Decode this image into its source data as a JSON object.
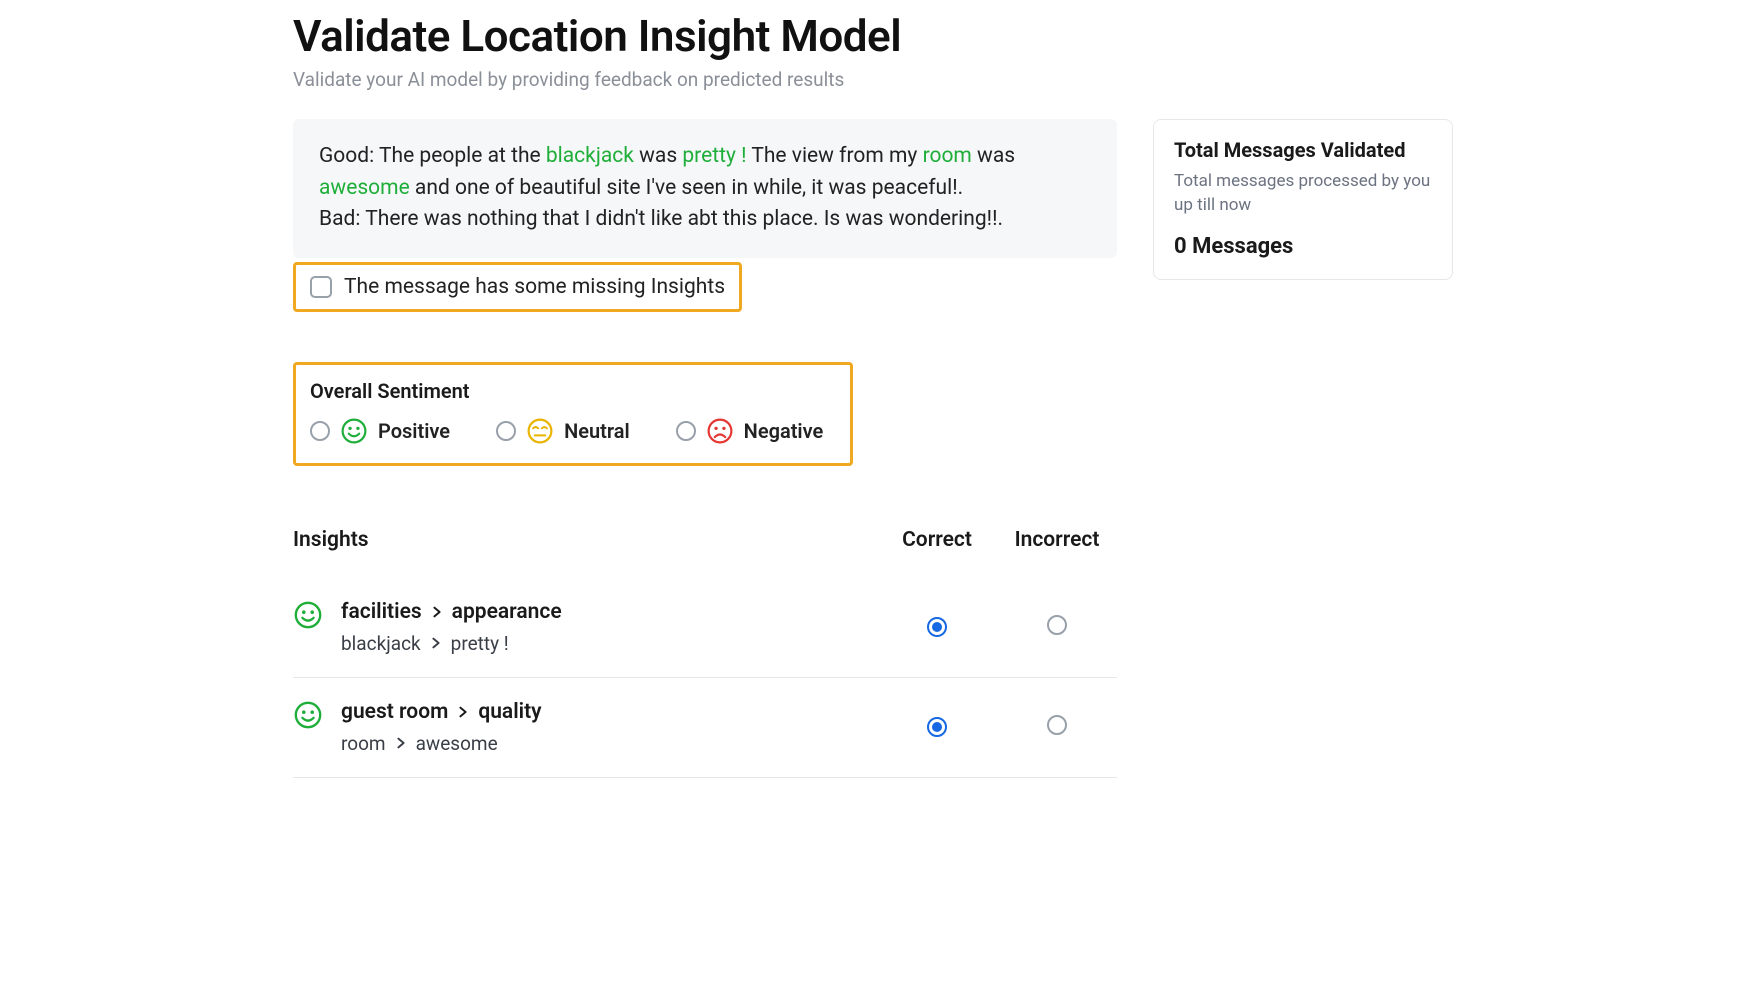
{
  "header": {
    "title": "Validate Location Insight Model",
    "subtitle": "Validate your AI model by providing feedback on predicted results"
  },
  "message": {
    "good_label": "Good:",
    "good_parts": [
      {
        "t": "  The people at the "
      },
      {
        "t": "blackjack",
        "hl": true
      },
      {
        "t": " was "
      },
      {
        "t": "pretty !",
        "hl": true
      },
      {
        "t": " The view from my "
      },
      {
        "t": "room",
        "hl": true
      },
      {
        "t": " was "
      },
      {
        "t": "awesome",
        "hl": true
      },
      {
        "t": " and one of beautiful site I've seen in while, it was peaceful!."
      }
    ],
    "bad_label": "Bad:",
    "bad_text": "  There was nothing that I didn't like abt this place. Is was wondering!!."
  },
  "missing": {
    "label": "The message has some missing Insights",
    "checked": false
  },
  "sentiment": {
    "title": "Overall Sentiment",
    "options": [
      {
        "key": "positive",
        "label": "Positive",
        "color": "#1fae3a",
        "selected": false
      },
      {
        "key": "neutral",
        "label": "Neutral",
        "color": "#e9b400",
        "selected": false
      },
      {
        "key": "negative",
        "label": "Negative",
        "color": "#e53732",
        "selected": false
      }
    ]
  },
  "insights": {
    "title": "Insights",
    "col_correct": "Correct",
    "col_incorrect": "Incorrect",
    "rows": [
      {
        "sentiment": "positive",
        "category": "facilities",
        "subcategory": "appearance",
        "term1": "blackjack",
        "term2": "pretty !",
        "value": "correct"
      },
      {
        "sentiment": "positive",
        "category": "guest room",
        "subcategory": "quality",
        "term1": "room",
        "term2": "awesome",
        "value": "correct"
      }
    ]
  },
  "side": {
    "total": {
      "title": "Total Messages Validated",
      "subtitle": "Total messages processed by you up till now",
      "value": "0 Messages"
    }
  }
}
